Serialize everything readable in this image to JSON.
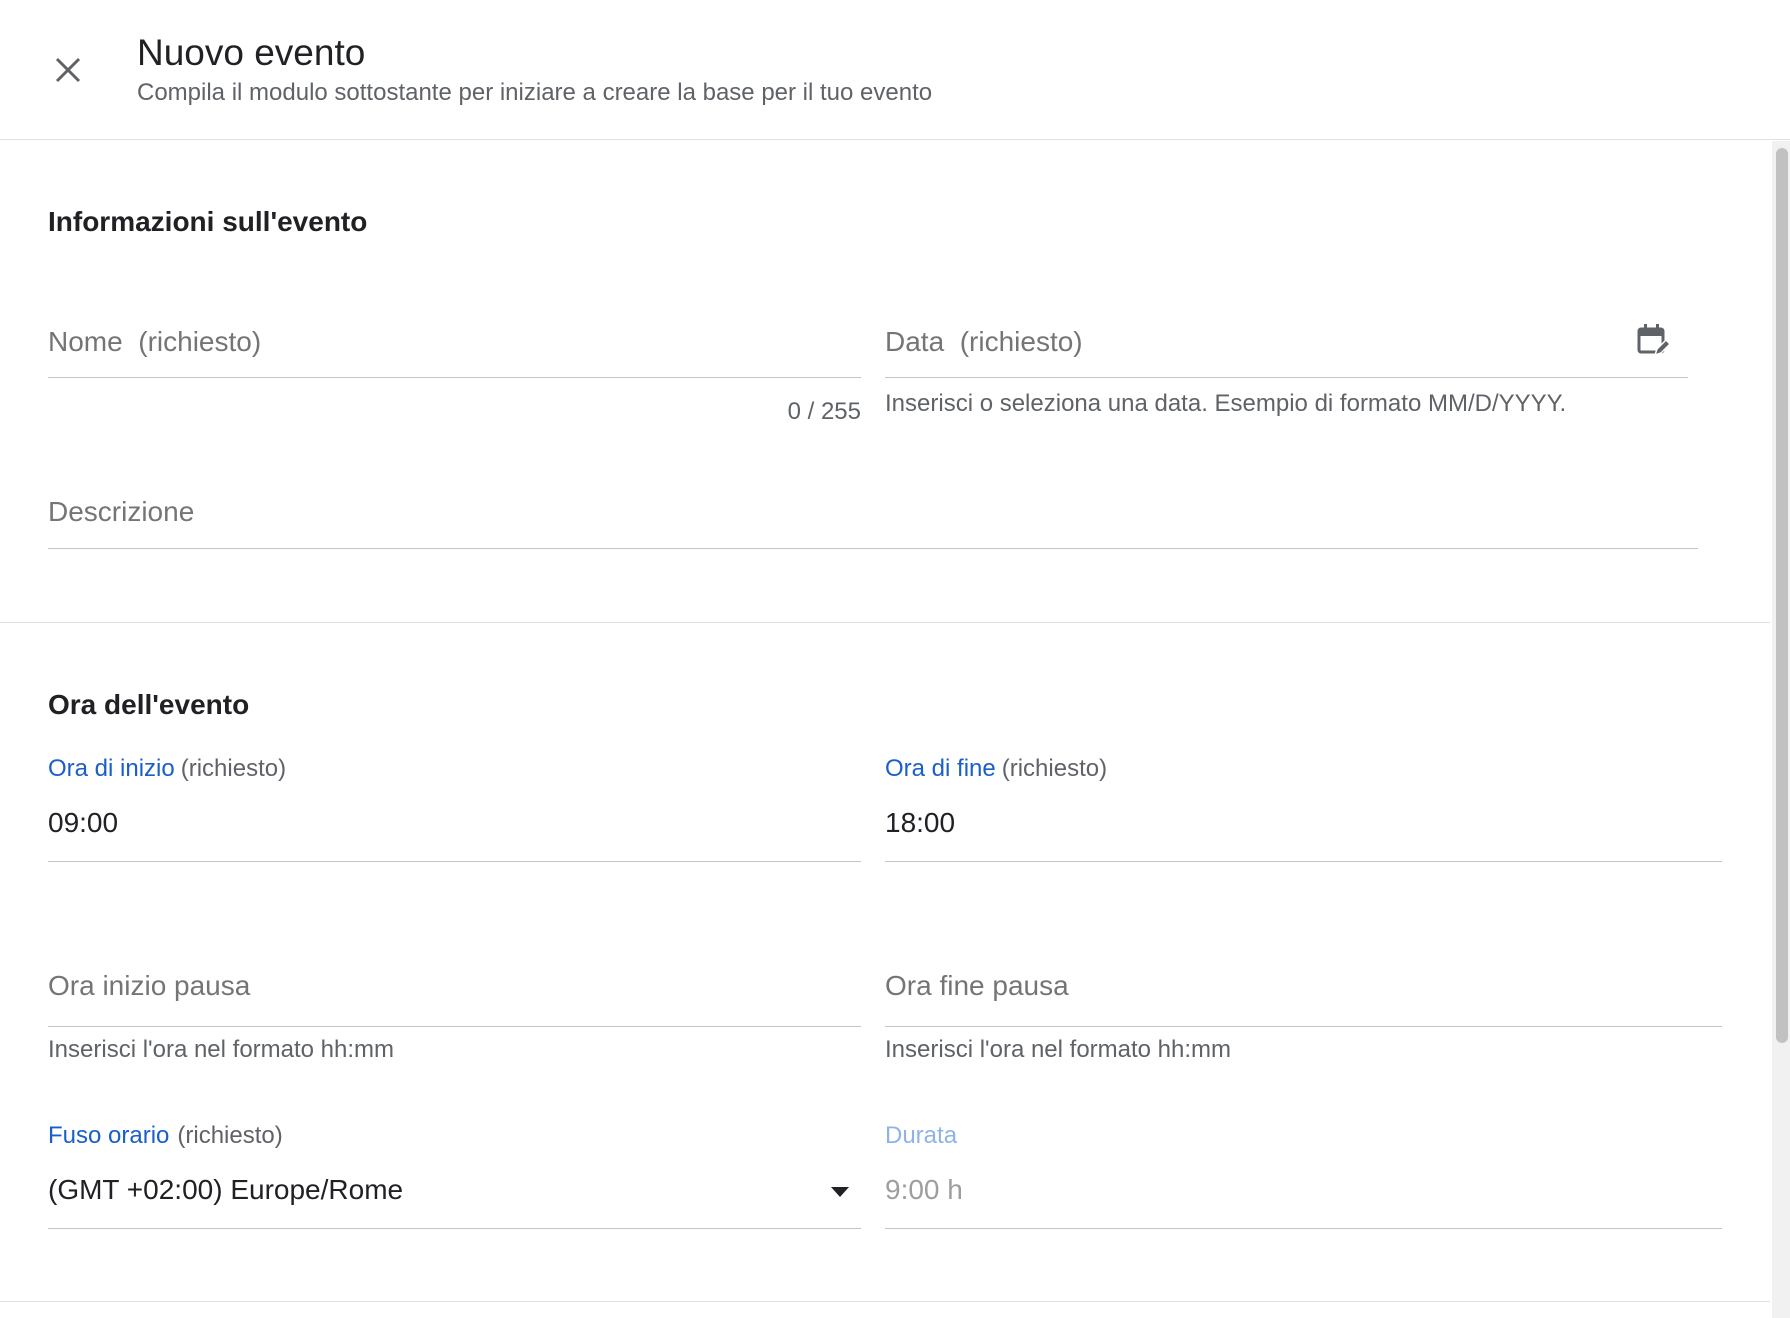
{
  "header": {
    "title": "Nuovo evento",
    "subtitle": "Compila il modulo sottostante per iniziare a creare la base per il tuo evento"
  },
  "event_info": {
    "section_title": "Informazioni sull'evento",
    "name_field": {
      "label": "Nome",
      "required": "(richiesto)",
      "value": "",
      "counter": "0 / 255"
    },
    "date_field": {
      "label": "Data",
      "required": "(richiesto)",
      "value": "",
      "helper": "Inserisci o seleziona una data. Esempio di formato MM/D/YYYY.",
      "icon": "calendar-edit-icon"
    },
    "description_field": {
      "label": "Descrizione",
      "value": ""
    }
  },
  "event_time": {
    "section_title": "Ora dell'evento",
    "start_time": {
      "label": "Ora di inizio",
      "required": "(richiesto)",
      "value": "09:00"
    },
    "end_time": {
      "label": "Ora di fine",
      "required": "(richiesto)",
      "value": "18:00"
    },
    "break_start": {
      "label": "Ora inizio pausa",
      "value": "",
      "helper": "Inserisci l'ora nel formato hh:mm"
    },
    "break_end": {
      "label": "Ora fine pausa",
      "value": "",
      "helper": "Inserisci l'ora nel formato hh:mm"
    },
    "timezone": {
      "label": "Fuso orario",
      "required": "(richiesto)",
      "value": "(GMT +02:00) Europe/Rome",
      "icon": "dropdown-arrow-icon"
    },
    "duration": {
      "label": "Durata",
      "value": "9:00 h"
    }
  },
  "colors": {
    "accent": "#1a5fc7",
    "text": "#202124",
    "secondary_text": "#5f6368",
    "divider": "#e0e0e0"
  }
}
